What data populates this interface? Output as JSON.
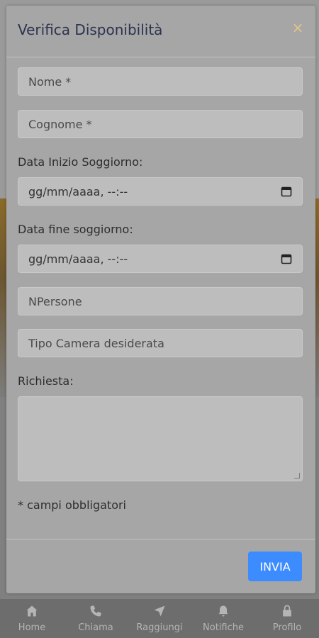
{
  "modal": {
    "title": "Verifica Disponibilità",
    "close_icon": "close-icon",
    "fields": {
      "first_name_placeholder": "Nome *",
      "last_name_placeholder": "Cognome *",
      "start_date_label": "Data Inizio Soggiorno:",
      "start_date_value": "gg/mm/aaaa, --:--",
      "end_date_label": "Data fine soggiorno:",
      "end_date_value": "gg/mm/aaaa, --:--",
      "people_placeholder": "NPersone",
      "room_type_placeholder": "Tipo Camera desiderata",
      "request_label": "Richiesta:"
    },
    "required_note": "* campi obbligatori",
    "submit_label": "INVIA"
  },
  "tabbar": {
    "items": [
      {
        "label": "Home",
        "icon": "home-icon"
      },
      {
        "label": "Chiama",
        "icon": "phone-icon"
      },
      {
        "label": "Raggiungi",
        "icon": "navigation-icon"
      },
      {
        "label": "Notifiche",
        "icon": "bell-icon"
      },
      {
        "label": "Profilo",
        "icon": "lock-icon"
      }
    ]
  },
  "colors": {
    "accent": "#3c8cff",
    "close": "#e3c58a",
    "title": "#2c3350"
  }
}
